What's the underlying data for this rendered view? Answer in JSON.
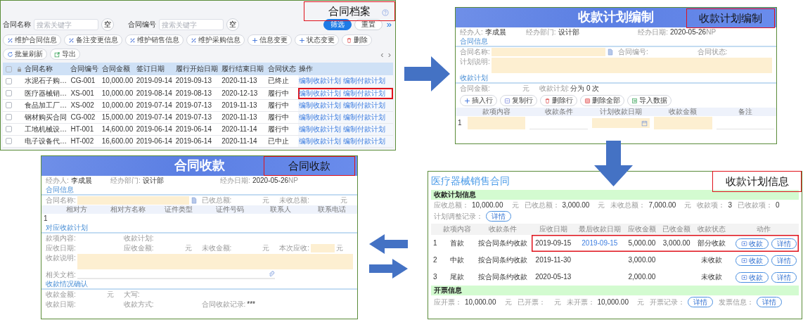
{
  "archive": {
    "callout": "合同档案",
    "filters": [
      {
        "label": "合同名称",
        "placeholder": "搜索关键字",
        "clear": "空"
      },
      {
        "label": "合同编号",
        "placeholder": "搜索关键字",
        "clear": "空"
      }
    ],
    "actions": [
      {
        "label": "筛选",
        "kind": "primary"
      },
      {
        "label": "重置",
        "kind": "secondary"
      }
    ],
    "expand": "»",
    "toolbar": [
      {
        "label": "维护合同信息",
        "kind": "edit"
      },
      {
        "label": "备注变更信息",
        "kind": "edit"
      },
      {
        "label": "维护销售信息",
        "kind": "edit"
      },
      {
        "label": "维护采购信息",
        "kind": "edit"
      },
      {
        "label": "信息变更",
        "kind": "add"
      },
      {
        "label": "状态变更",
        "kind": "add"
      },
      {
        "label": "删除",
        "kind": "delete"
      },
      {
        "label": "批量刷新",
        "kind": "refresh"
      },
      {
        "label": "导出",
        "kind": "export"
      }
    ],
    "pager": [
      "‹",
      "›"
    ],
    "select_all": {
      "checked": false
    },
    "columns": [
      "合同名称",
      "合同编号",
      "合同金额",
      "签订日期",
      "履行开始日期",
      "履行结束日期",
      "合同状态",
      "操作"
    ],
    "rows": [
      {
        "checked": false,
        "highlighted": false,
        "cells": [
          "水泥石子购…",
          "CG-001",
          "10,000.00",
          "2019-09-14",
          "2019-09-13",
          "2020-11-13",
          "已终止"
        ],
        "links": [
          "编制收款计划",
          "编制付款计划"
        ]
      },
      {
        "checked": false,
        "highlighted": true,
        "cells": [
          "医疗器械销…",
          "XS-001",
          "10,000.00",
          "2019-08-14",
          "2019-08-13",
          "2020-12-13",
          "履行中"
        ],
        "links": [
          "编制收款计划",
          "编制付款计划"
        ]
      },
      {
        "checked": false,
        "highlighted": false,
        "cells": [
          "食品加工厂…",
          "XS-002",
          "10,000.00",
          "2019-07-14",
          "2019-07-13",
          "2019-11-13",
          "履行中"
        ],
        "links": [
          "编制收款计划",
          "编制付款计划"
        ]
      },
      {
        "checked": false,
        "highlighted": false,
        "cells": [
          "钢材购买合同",
          "CG-002",
          "15,000.00",
          "2019-07-14",
          "2019-07-13",
          "2020-11-13",
          "履行中"
        ],
        "links": [
          "编制收款计划",
          "编制付款计划"
        ]
      },
      {
        "checked": false,
        "highlighted": false,
        "cells": [
          "工地机械设…",
          "HT-001",
          "14,600.00",
          "2019-06-14",
          "2019-06-14",
          "2020-11-14",
          "履行中"
        ],
        "links": [
          "编制收款计划",
          "编制付款计划"
        ]
      },
      {
        "checked": false,
        "highlighted": false,
        "cells": [
          "电子设备代…",
          "HT-002",
          "16,600.00",
          "2019-06-14",
          "2019-06-14",
          "2020-11-14",
          "已中止"
        ],
        "links": [
          "编制收款计划",
          "编制付款计划"
        ]
      }
    ]
  },
  "plan_editor": {
    "callout": "收款计划编制",
    "banner": "收款计划编制",
    "meta": [
      {
        "label": "经办人:",
        "value": "李成晨"
      },
      {
        "label": "经办部门:",
        "value": "设计部"
      },
      {
        "label": "经办日期:",
        "value": "2020-05-26"
      },
      {
        "label": "NP"
      }
    ],
    "sections": [
      {
        "title": "合同信息",
        "rows": [
          [
            {
              "label": "合同名称:",
              "kind": "picker"
            },
            {
              "label": "合同编号:"
            },
            {
              "label": "合同状态:"
            }
          ],
          [
            {
              "label": "计划说明:",
              "kind": "textarea"
            }
          ]
        ]
      },
      {
        "title": "收款计划",
        "rows": [
          [
            {
              "label": "合同金额:",
              "unit": "元"
            },
            {
              "label": "收款计划:",
              "value": "分为 0 次"
            }
          ]
        ]
      }
    ],
    "toolbar": [
      {
        "label": "插入行",
        "kind": "add"
      },
      {
        "label": "复制行",
        "kind": "copy"
      },
      {
        "label": "删除行",
        "kind": "delete"
      },
      {
        "label": "删除全部",
        "kind": "delete_all"
      },
      {
        "label": "导入数据",
        "kind": "import"
      }
    ],
    "table": {
      "columns": [
        "款项内容",
        "收款条件",
        "计划收款日期",
        "收款金额",
        "备注"
      ],
      "rows": [
        {
          "no": "1",
          "cells": [
            {
              "kind": "input"
            },
            {
              "kind": "line"
            },
            {
              "kind": "date"
            },
            {
              "kind": "input"
            },
            {
              "kind": "line"
            }
          ]
        }
      ]
    }
  },
  "receipt": {
    "callout": "合同收款",
    "banner": "合同收款",
    "meta": [
      {
        "label": "经办人:",
        "value": "李成晨"
      },
      {
        "label": "经办部门:",
        "value": "设计部"
      },
      {
        "label": "经办日期:",
        "value": "2020-05-26"
      },
      {
        "label": "NP"
      }
    ],
    "sections": [
      {
        "title": "合同信息",
        "rows": [
          [
            {
              "label": "合同名称:",
              "kind": "picker"
            },
            {
              "label": "已收总额:",
              "unit": "元"
            },
            {
              "label": "未收总额:",
              "unit": "元"
            }
          ]
        ],
        "table": {
          "columns": [
            "相对方",
            "相对方名称",
            "证件类型",
            "证件号码",
            "联系人",
            "联系电话"
          ],
          "rows": [
            {
              "no": "1"
            }
          ]
        }
      },
      {
        "title": "对应收款计划",
        "rows": [
          [
            {
              "label": "款项内容:"
            },
            {
              "label": "收款计划:"
            }
          ],
          [
            {
              "label": "应收日期:"
            },
            {
              "label": "应收金额:",
              "unit": "元"
            },
            {
              "label": "未收金额:",
              "unit": "元"
            },
            {
              "label": "本次应收:",
              "kind": "input",
              "unit": "元"
            }
          ],
          [
            {
              "label": "收款说明:",
              "kind": "textarea"
            }
          ],
          [
            {
              "label": "相关文档:",
              "kind": "attach"
            }
          ]
        ]
      },
      {
        "title": "收款情况确认",
        "rows": [
          [
            {
              "label": "收款金额:",
              "unit": "元"
            },
            {
              "label": "大写:"
            }
          ],
          [
            {
              "label": "收款日期:"
            },
            {
              "label": "收款方式:"
            },
            {
              "label": "合同收款记录:",
              "value": "***"
            }
          ]
        ]
      }
    ]
  },
  "plan_info": {
    "callout": "收款计划信息",
    "title": "医疗器械销售合同",
    "plan_section": "收款计划信息",
    "summary": [
      {
        "label": "应收总额：",
        "value": "10,000.00",
        "unit": "元"
      },
      {
        "label": "已收总额：",
        "value": "3,000.00",
        "unit": "元"
      },
      {
        "label": "未收总额：",
        "value": "7,000.00",
        "unit": "元"
      },
      {
        "label": "收款项：",
        "value": "3"
      },
      {
        "label": "已收款项：",
        "value": "0"
      },
      {
        "label": "计划调整记录：",
        "button": "详情"
      }
    ],
    "columns": [
      "款项内容",
      "收款条件",
      "应收日期",
      "最后收款日期",
      "应收金额",
      "已收金额",
      "收款状态",
      "动作"
    ],
    "rows": [
      {
        "no": "1",
        "content": "首款",
        "condition": "按合同条约收款",
        "due_date": "2019-09-15",
        "last_date": "2019-09-15",
        "due_amount": "5,000.00",
        "received": "3,000.00",
        "status": "部分收款",
        "highlighted": true,
        "actions": [
          {
            "label": "收款",
            "kind": "receive"
          },
          {
            "label": "详情",
            "kind": "detail"
          }
        ]
      },
      {
        "no": "2",
        "content": "中款",
        "condition": "按合同条约收款",
        "due_date": "2019-11-30",
        "due_amount": "3,000.00",
        "status": "未收款",
        "highlighted": false,
        "actions": [
          {
            "label": "收款",
            "kind": "receive"
          },
          {
            "label": "详情",
            "kind": "detail"
          }
        ]
      },
      {
        "no": "3",
        "content": "尾款",
        "condition": "按合同条约收款",
        "due_date": "2020-05-13",
        "due_amount": "2,000.00",
        "status": "未收款",
        "highlighted": false,
        "actions": [
          {
            "label": "收款",
            "kind": "receive"
          },
          {
            "label": "详情",
            "kind": "detail"
          }
        ]
      }
    ],
    "invoice_section": "开票信息",
    "invoice": [
      {
        "label": "应开票：",
        "value": "10,000.00",
        "unit": "元"
      },
      {
        "label": "已开票：",
        "unit": "元"
      },
      {
        "label": "未开票：",
        "value": "10,000.00",
        "unit": "元"
      },
      {
        "label": "开票记录：",
        "button": "详情"
      },
      {
        "label": "发票信息：",
        "button": "详情"
      }
    ]
  }
}
